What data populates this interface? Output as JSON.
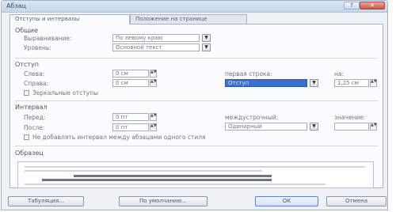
{
  "window": {
    "title": "Абзац",
    "help_glyph": "?",
    "close_glyph": "✕"
  },
  "tabs": [
    {
      "label": "Отступы и интервалы"
    },
    {
      "label": "Положение на странице"
    }
  ],
  "general": {
    "heading": "Общие",
    "alignment_label": "Выравнивание:",
    "alignment_value": "По левому краю",
    "level_label": "Уровень:",
    "level_value": "Основной текст"
  },
  "indent": {
    "heading": "Отступ",
    "left_label": "Слева:",
    "left_value": "0 см",
    "right_label": "Справа:",
    "right_value": "0 см",
    "mirror_label": "Зеркальные отступы",
    "first_line_label": "первая строка:",
    "first_line_value": "Отступ",
    "by_label": "на:",
    "by_value": "1,25 см"
  },
  "spacing": {
    "heading": "Интервал",
    "before_label": "Перед:",
    "before_value": "0 пт",
    "after_label": "После:",
    "after_value": "0 пт",
    "no_space_label": "Не добавлять интервал между абзацами одного стиля",
    "line_spacing_label": "междустрочный:",
    "line_spacing_value": "Одинарный",
    "value_label": "значение:",
    "value_value": ""
  },
  "preview": {
    "heading": "Образец"
  },
  "buttons": {
    "tabulation": "Табуляция...",
    "default": "По умолчанию...",
    "ok": "ОК",
    "cancel": "Отмена"
  },
  "glyphs": {
    "dropdown": "▼",
    "spin": "▲▼"
  }
}
